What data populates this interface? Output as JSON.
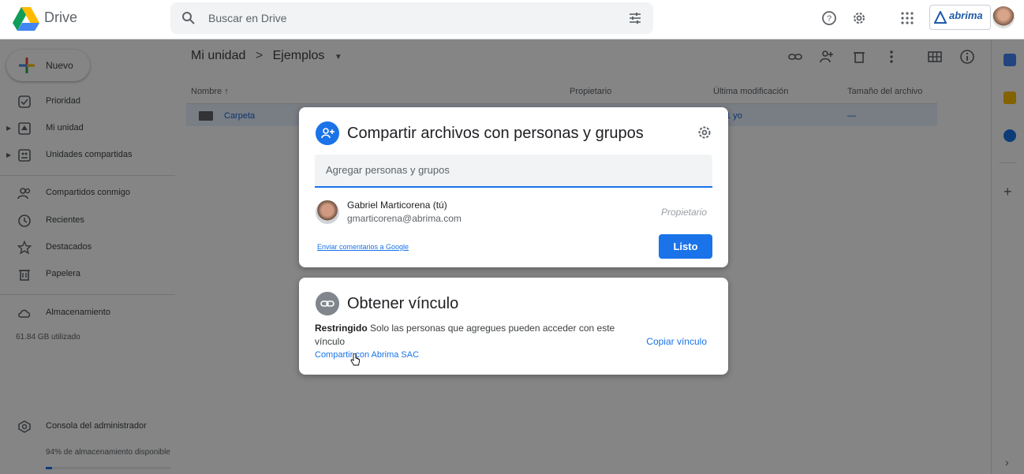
{
  "app": {
    "name": "Drive"
  },
  "search": {
    "placeholder": "Buscar en Drive"
  },
  "sidebar": {
    "new_label": "Nuevo",
    "items": [
      {
        "label": "Prioridad"
      },
      {
        "label": "Mi unidad"
      },
      {
        "label": "Unidades compartidas"
      },
      {
        "label": "Compartidos conmigo"
      },
      {
        "label": "Recientes"
      },
      {
        "label": "Destacados"
      },
      {
        "label": "Papelera"
      },
      {
        "label": "Almacenamiento"
      }
    ],
    "storage_used": "61.84 GB utilizado",
    "admin_label": "Consola del administrador",
    "storage_available": "94% de almacenamiento disponible",
    "storage_available_fraction": 0.05
  },
  "breadcrumb": {
    "root": "Mi unidad",
    "separator": ">",
    "current": "Ejemplos"
  },
  "table": {
    "headers": {
      "name": "Nombre",
      "owner": "Propietario",
      "modified": "Última modificación",
      "size": "Tamaño del archivo"
    },
    "rows": [
      {
        "name": "Carpeta",
        "modified": "1 yo",
        "size": "—"
      }
    ]
  },
  "brand": {
    "text": "abrima"
  },
  "share_dialog": {
    "title": "Compartir archivos con personas y grupos",
    "add_placeholder": "Agregar personas y grupos",
    "person": {
      "name": "Gabriel Marticorena (tú)",
      "email": "gmarticorena@abrima.com",
      "role": "Propietario"
    },
    "feedback_link": "Enviar comentarios a Google",
    "done_label": "Listo"
  },
  "link_dialog": {
    "title": "Obtener vínculo",
    "restricted_label": "Restringido",
    "restricted_desc": "Solo las personas que agregues pueden acceder con este vínculo",
    "share_org_link": "Compartir con Abrima SAC",
    "copy_link_label": "Copiar vínculo"
  },
  "colors": {
    "accent": "#1a73e8",
    "selected_row": "#e8f0fe",
    "overlay": "#000000"
  }
}
